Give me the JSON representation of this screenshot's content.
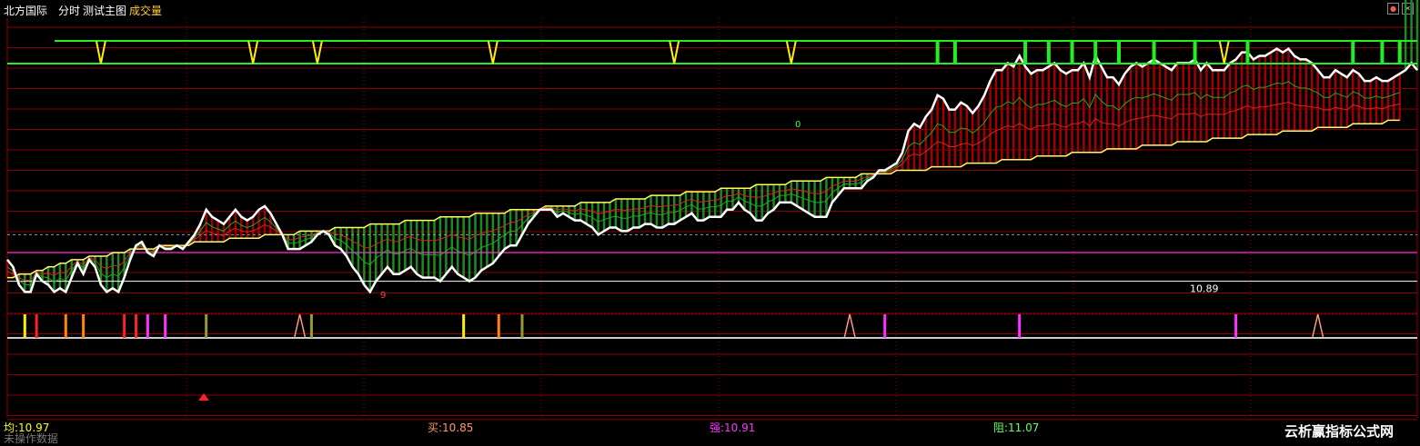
{
  "header": {
    "stock_name": "北方国际",
    "period_label": "分时",
    "indicator_label": "测试主图",
    "volume_label": "成交量"
  },
  "price_label": "10.89",
  "marker_label_1": "9",
  "marker_label_2": "0",
  "footer": {
    "avg": "均:10.97",
    "buy": "买:10.85",
    "strong": "强:10.91",
    "resist": "阻:11.07",
    "note": "未操作数据",
    "watermark": "云析赢指标公式网"
  },
  "window_controls": {
    "restore_icon": "restore-icon",
    "close_icon": "close-icon"
  },
  "colors": {
    "background": "#000000",
    "grid": "#8b0000",
    "price_line": "#ffffff",
    "avg_line": "#ffff66",
    "up_bar": "#a00000",
    "down_bar": "#1f8a1f",
    "band": "#22ee22",
    "band_marker": "#ffee00",
    "magenta": "#ff33ff",
    "footer_avg": "#ffff00",
    "footer_buy": "#ff9966",
    "footer_strong": "#ff33ff",
    "footer_resist": "#66ff66"
  },
  "chart_data": {
    "type": "line",
    "title": "",
    "x": "minute index 0–240",
    "series": [
      {
        "values": [
          10.95,
          10.93,
          10.88,
          10.86,
          10.86,
          10.91,
          10.89,
          10.88,
          10.86,
          10.87,
          10.86,
          10.9,
          10.94,
          10.91,
          10.95,
          10.93,
          10.88,
          10.86,
          10.87,
          10.86,
          10.9,
          10.95,
          10.99,
          11.0,
          10.97,
          10.96,
          10.99,
          10.98,
          10.98,
          10.99,
          10.98,
          11.0,
          11.02,
          11.05,
          11.09,
          11.07,
          11.06,
          11.05,
          11.07,
          11.09,
          11.07,
          11.06,
          11.07,
          11.09,
          11.1,
          11.08,
          11.05,
          11.02,
          10.98,
          10.98,
          10.98,
          10.99,
          11.0,
          11.02,
          11.03,
          11.02,
          10.99,
          10.98,
          10.96,
          10.93,
          10.91,
          10.88,
          10.86,
          10.89,
          10.91,
          10.93,
          10.91,
          10.91,
          10.92,
          10.93,
          10.91,
          10.9,
          10.9,
          10.9,
          10.89,
          10.91,
          10.93,
          10.91,
          10.9,
          10.89,
          10.9,
          10.92,
          10.93,
          10.94,
          10.96,
          10.98,
          10.99,
          10.99,
          11.02,
          11.05,
          11.07,
          11.09,
          11.09,
          11.09,
          11.07,
          11.08,
          11.07,
          11.06,
          11.06,
          11.05,
          11.04,
          11.02,
          11.03,
          11.04,
          11.04,
          11.03,
          11.03,
          11.04,
          11.04,
          11.05,
          11.05,
          11.04,
          11.04,
          11.05,
          11.05,
          11.06,
          11.07,
          11.08,
          11.06,
          11.06,
          11.07,
          11.07,
          11.07,
          11.09,
          11.09,
          11.11,
          11.09,
          11.08,
          11.06,
          11.06,
          11.08,
          11.09,
          11.11,
          11.11,
          11.11,
          11.1,
          11.09,
          11.08,
          11.07,
          11.07,
          11.07,
          11.11,
          11.13,
          11.15,
          11.15,
          11.15,
          11.15,
          11.17,
          11.18,
          11.2,
          11.2,
          11.21,
          11.22,
          11.25,
          11.31,
          11.33,
          11.32,
          11.35,
          11.37,
          11.41,
          11.4,
          11.37,
          11.37,
          11.39,
          11.38,
          11.36,
          11.38,
          11.41,
          11.45,
          11.48,
          11.48,
          11.5,
          11.49,
          11.52,
          11.49,
          11.47,
          11.48,
          11.48,
          11.49,
          11.5,
          11.48,
          11.47,
          11.48,
          11.48,
          11.5,
          11.46,
          11.52,
          11.49,
          11.46,
          11.46,
          11.44,
          11.47,
          11.49,
          11.5,
          11.49,
          11.5,
          11.51,
          11.5,
          11.49,
          11.48,
          11.5,
          11.5,
          11.5,
          11.51,
          11.48,
          11.5,
          11.48,
          11.48,
          11.48,
          11.5,
          11.51,
          11.53,
          11.53,
          11.51,
          11.52,
          11.52,
          11.53,
          11.54,
          11.53,
          11.54,
          11.52,
          11.51,
          11.51,
          11.5,
          11.48,
          11.46,
          11.46,
          11.48,
          11.47,
          11.46,
          11.48,
          11.47,
          11.45,
          11.45,
          11.46,
          11.45,
          11.45,
          11.46,
          11.47,
          11.48,
          11.5,
          11.48
        ]
      },
      {
        "values": [
          10.9,
          10.9,
          10.91,
          10.91,
          10.91,
          10.92,
          10.92,
          10.93,
          10.93,
          10.94,
          10.94,
          10.95,
          10.95,
          10.95,
          10.96,
          10.96,
          10.96,
          10.96,
          10.97,
          10.97,
          10.97,
          10.98,
          10.98,
          10.98,
          10.98,
          10.98,
          10.99,
          10.99,
          10.99,
          10.99,
          10.99,
          10.99,
          11.0,
          11.0,
          11.0,
          11.0,
          11.0,
          11.0,
          11.01,
          11.01,
          11.01,
          11.01,
          11.01,
          11.01,
          11.02,
          11.02,
          11.02,
          11.02,
          11.02,
          11.02,
          11.03,
          11.03,
          11.03,
          11.03,
          11.03,
          11.03,
          11.04,
          11.04,
          11.04,
          11.04,
          11.04,
          11.04,
          11.05,
          11.05,
          11.05,
          11.05,
          11.05,
          11.05,
          11.06,
          11.06,
          11.06,
          11.06,
          11.06,
          11.06,
          11.07,
          11.07,
          11.07,
          11.07,
          11.07,
          11.07,
          11.08,
          11.08,
          11.08,
          11.08,
          11.08,
          11.08,
          11.09,
          11.09,
          11.09,
          11.09,
          11.09,
          11.09,
          11.1,
          11.1,
          11.1,
          11.1,
          11.1,
          11.1,
          11.11,
          11.11,
          11.11,
          11.11,
          11.11,
          11.11,
          11.12,
          11.12,
          11.12,
          11.12,
          11.12,
          11.12,
          11.13,
          11.13,
          11.13,
          11.13,
          11.13,
          11.13,
          11.14,
          11.14,
          11.14,
          11.14,
          11.14,
          11.14,
          11.15,
          11.15,
          11.15,
          11.15,
          11.15,
          11.15,
          11.16,
          11.16,
          11.16,
          11.16,
          11.16,
          11.16,
          11.17,
          11.17,
          11.17,
          11.17,
          11.17,
          11.17,
          11.18,
          11.18,
          11.18,
          11.18,
          11.18,
          11.18,
          11.19,
          11.19,
          11.19,
          11.19,
          11.19,
          11.19,
          11.2,
          11.2,
          11.2,
          11.2,
          11.2,
          11.2,
          11.21,
          11.21,
          11.21,
          11.21,
          11.21,
          11.21,
          11.22,
          11.22,
          11.22,
          11.22,
          11.22,
          11.22,
          11.23,
          11.23,
          11.23,
          11.23,
          11.23,
          11.23,
          11.24,
          11.24,
          11.24,
          11.24,
          11.24,
          11.24,
          11.25,
          11.25,
          11.25,
          11.25,
          11.25,
          11.25,
          11.26,
          11.26,
          11.26,
          11.26,
          11.26,
          11.26,
          11.27,
          11.27,
          11.27,
          11.27,
          11.27,
          11.27,
          11.28,
          11.28,
          11.28,
          11.28,
          11.28,
          11.28,
          11.29,
          11.29,
          11.29,
          11.29,
          11.29,
          11.29,
          11.3,
          11.3,
          11.3,
          11.3,
          11.3,
          11.3,
          11.31,
          11.31,
          11.31,
          11.31,
          11.31,
          11.31,
          11.32,
          11.32,
          11.32,
          11.32,
          11.32,
          11.32,
          11.33,
          11.33,
          11.33,
          11.33,
          11.33,
          11.33,
          11.34,
          11.34,
          11.34
        ]
      }
    ],
    "ylim": [
      10.8,
      11.6
    ],
    "reference_levels": [
      11.02,
      10.97,
      10.89
    ],
    "band_markers_yellow": [
      16,
      42,
      53,
      83,
      114,
      134,
      208
    ],
    "band_markers_green": [
      159,
      162,
      174,
      178,
      182,
      186,
      190,
      196,
      203,
      212,
      230,
      235,
      238
    ],
    "signal_bars": [
      {
        "x": 3,
        "color": "#ffee00"
      },
      {
        "x": 5,
        "color": "#ff2222"
      },
      {
        "x": 10,
        "color": "#ff8800"
      },
      {
        "x": 13,
        "color": "#ff8800"
      },
      {
        "x": 20,
        "color": "#ff2222"
      },
      {
        "x": 22,
        "color": "#ff2222"
      },
      {
        "x": 24,
        "color": "#ff33ff"
      },
      {
        "x": 27,
        "color": "#ff33ff"
      },
      {
        "x": 34,
        "color": "#999933"
      },
      {
        "x": 52,
        "color": "#999933"
      },
      {
        "x": 78,
        "color": "#ffee00"
      },
      {
        "x": 84,
        "color": "#ff8800"
      },
      {
        "x": 88,
        "color": "#999933"
      },
      {
        "x": 150,
        "color": "#ff33ff"
      },
      {
        "x": 173,
        "color": "#ff33ff"
      },
      {
        "x": 210,
        "color": "#ff33ff"
      }
    ],
    "signal_peaks": [
      50,
      144,
      224
    ]
  }
}
